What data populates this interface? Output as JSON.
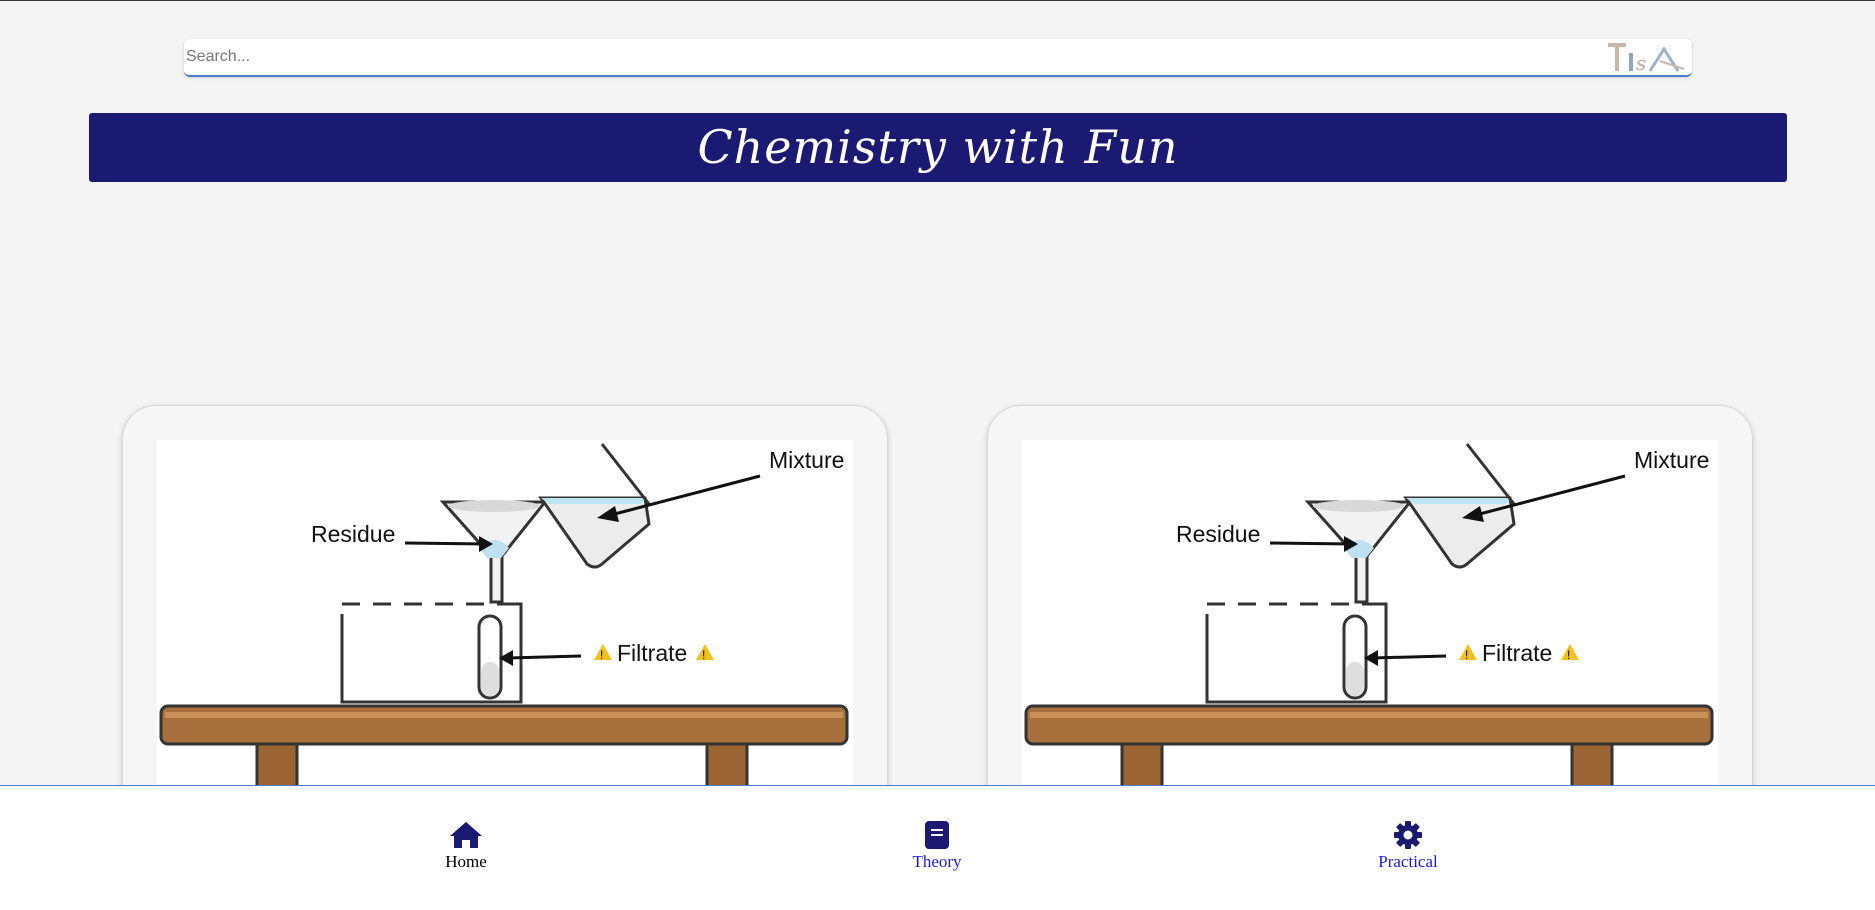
{
  "search": {
    "placeholder": "Search...",
    "logo_icon": "tisa-logo-icon"
  },
  "header": {
    "title": "Chemistry with Fun",
    "background": "#1a1a72"
  },
  "cards": [
    {
      "icon": "filtration-diagram",
      "labels": {
        "mixture": "Mixture",
        "residue": "Residue",
        "filtrate": "Filtrate"
      }
    },
    {
      "icon": "filtration-diagram",
      "labels": {
        "mixture": "Mixture",
        "residue": "Residue",
        "filtrate": "Filtrate"
      }
    }
  ],
  "nav": {
    "items": [
      {
        "label": "Home",
        "icon": "home-icon",
        "active": true
      },
      {
        "label": "Theory",
        "icon": "book-icon",
        "active": false
      },
      {
        "label": "Practical",
        "icon": "gear-icon",
        "active": false
      }
    ],
    "icon_color": "#1a1a72",
    "link_color": "#1a1ae6"
  }
}
